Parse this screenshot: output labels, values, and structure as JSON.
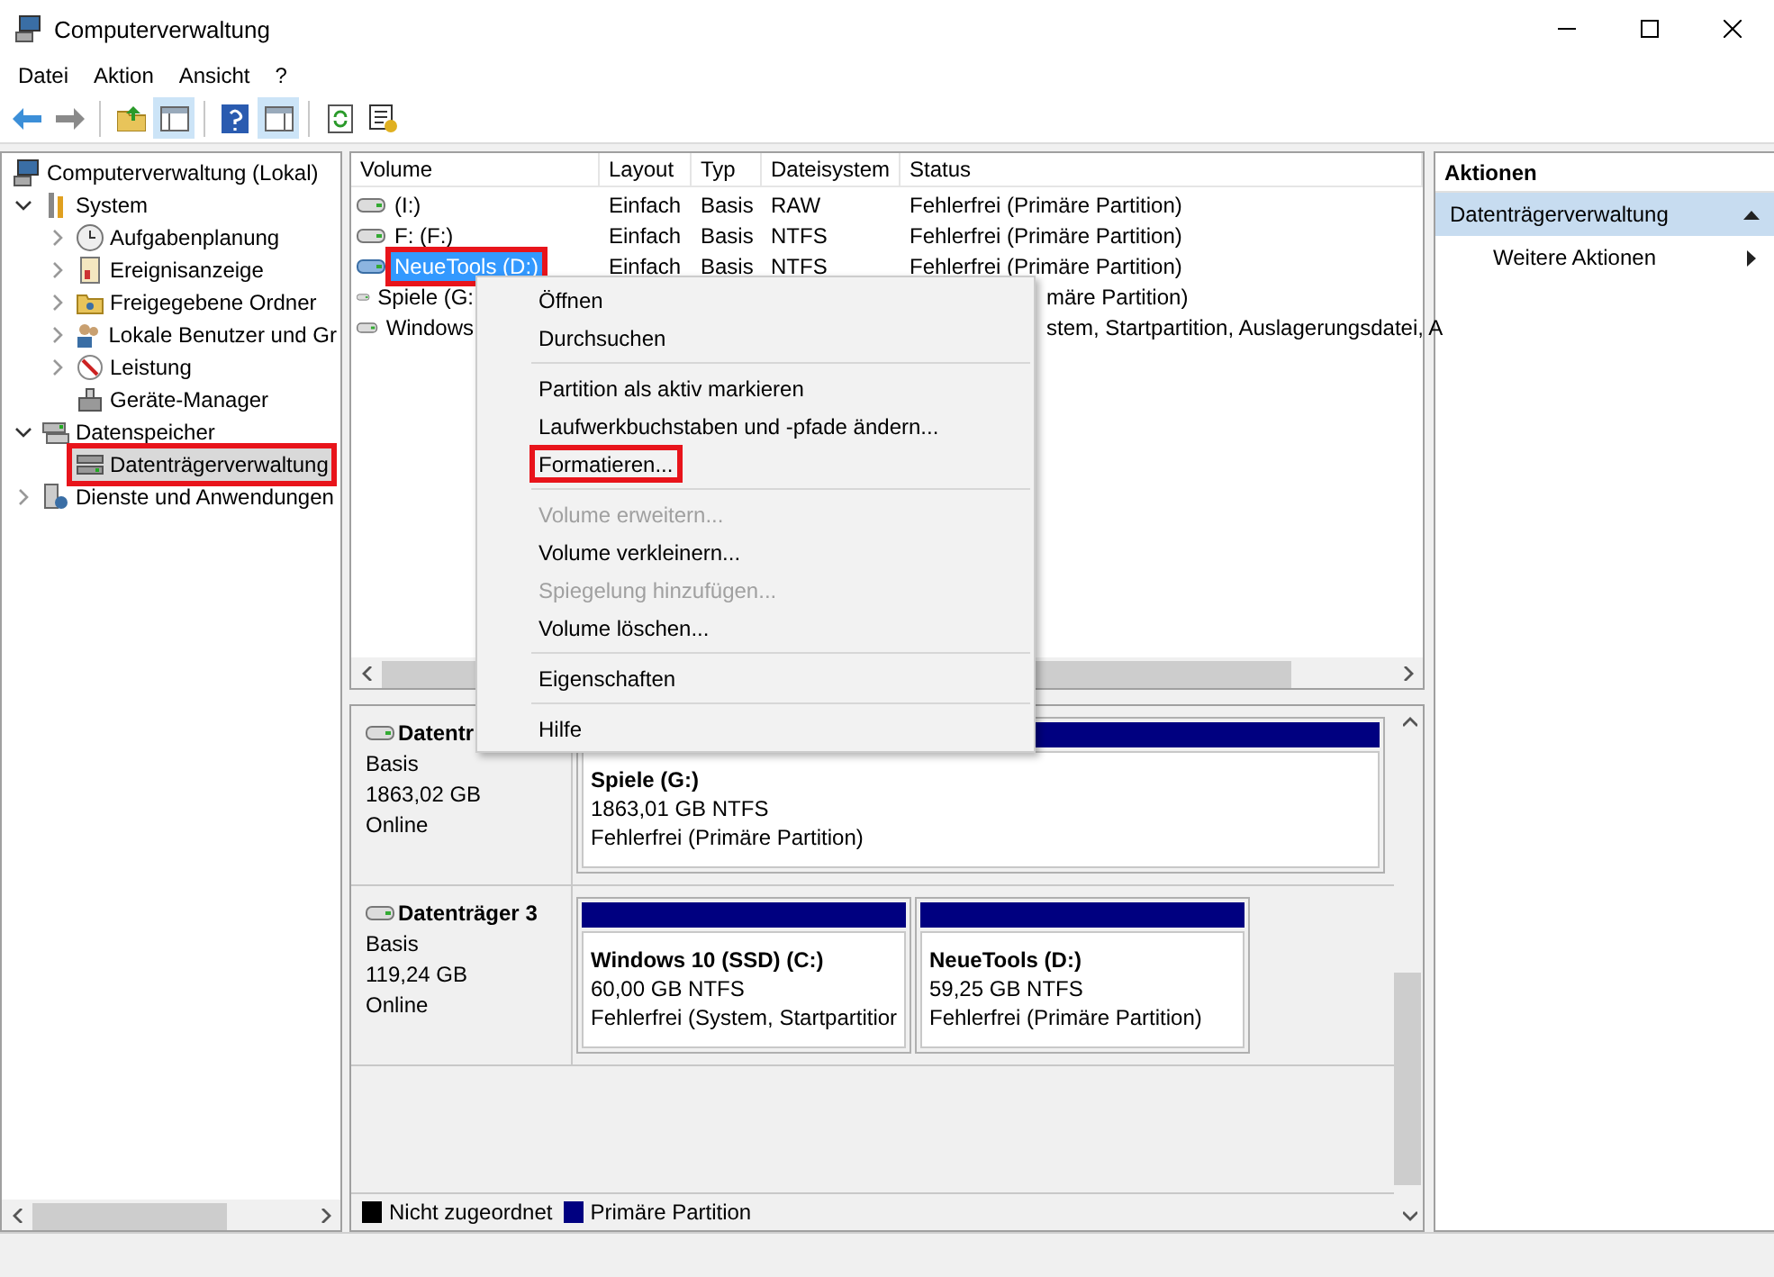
{
  "window": {
    "title": "Computerverwaltung"
  },
  "menu": [
    "Datei",
    "Aktion",
    "Ansicht",
    "?"
  ],
  "tree": [
    {
      "label": "Computerverwaltung (Lokal)",
      "selected": false,
      "highlighted": false,
      "children": [
        {
          "label": "System",
          "expanded": true,
          "selected": false,
          "highlighted": false,
          "children": [
            {
              "label": "Aufgabenplanung",
              "expanded": false,
              "selected": false,
              "highlighted": false
            },
            {
              "label": "Ereignisanzeige",
              "expanded": false,
              "selected": false,
              "highlighted": false
            },
            {
              "label": "Freigegebene Ordner",
              "expanded": false,
              "selected": false,
              "highlighted": false
            },
            {
              "label": "Lokale Benutzer und Gr",
              "expanded": false,
              "selected": false,
              "highlighted": false
            },
            {
              "label": "Leistung",
              "expanded": false,
              "selected": false,
              "highlighted": false
            },
            {
              "label": "Geräte-Manager",
              "selected": false,
              "highlighted": false
            }
          ]
        },
        {
          "label": "Datenspeicher",
          "expanded": true,
          "selected": false,
          "highlighted": false,
          "children": [
            {
              "label": "Datenträgerverwaltung",
              "selected": true,
              "highlighted": true
            }
          ]
        },
        {
          "label": "Dienste und Anwendungen",
          "expanded": false,
          "selected": false,
          "highlighted": false
        }
      ]
    }
  ],
  "volumes": {
    "columns": [
      "Volume",
      "Layout",
      "Typ",
      "Dateisystem",
      "Status"
    ],
    "rows": [
      {
        "covered": false,
        "selected": false,
        "highlighted": false,
        "cells": [
          "(I:)",
          "Einfach",
          "Basis",
          "RAW",
          "Fehlerfrei (Primäre Partition)"
        ]
      },
      {
        "covered": false,
        "selected": false,
        "highlighted": false,
        "cells": [
          "F: (F:)",
          "Einfach",
          "Basis",
          "NTFS",
          "Fehlerfrei (Primäre Partition)"
        ]
      },
      {
        "covered": false,
        "selected": true,
        "highlighted": true,
        "cells": [
          "NeueTools (D:)",
          "Einfach",
          "Basis",
          "NTFS",
          "Fehlerfrei (Primäre Partition)"
        ]
      },
      {
        "covered": true,
        "selected": false,
        "highlighted": false,
        "cells": [
          "Spiele (G:",
          "märe Partition)"
        ]
      },
      {
        "covered": true,
        "selected": false,
        "highlighted": false,
        "cells": [
          "Windows",
          "stem, Startpartition, Auslagerungsdatei, A"
        ]
      }
    ]
  },
  "context_menu": [
    {
      "kind": "item",
      "label": "Öffnen",
      "disabled": false,
      "highlighted": false
    },
    {
      "kind": "item",
      "label": "Durchsuchen",
      "disabled": false,
      "highlighted": false
    },
    {
      "kind": "separator"
    },
    {
      "kind": "item",
      "label": "Partition als aktiv markieren",
      "disabled": false,
      "highlighted": false
    },
    {
      "kind": "item",
      "label": "Laufwerkbuchstaben und -pfade ändern...",
      "disabled": false,
      "highlighted": false
    },
    {
      "kind": "item",
      "label": "Formatieren...",
      "disabled": false,
      "highlighted": true
    },
    {
      "kind": "separator"
    },
    {
      "kind": "item",
      "label": "Volume erweitern...",
      "disabled": true,
      "highlighted": false
    },
    {
      "kind": "item",
      "label": "Volume verkleinern...",
      "disabled": false,
      "highlighted": false
    },
    {
      "kind": "item",
      "label": "Spiegelung hinzufügen...",
      "disabled": true,
      "highlighted": false
    },
    {
      "kind": "item",
      "label": "Volume löschen...",
      "disabled": false,
      "highlighted": false
    },
    {
      "kind": "separator"
    },
    {
      "kind": "item",
      "label": "Eigenschaften",
      "disabled": false,
      "highlighted": false
    },
    {
      "kind": "separator"
    },
    {
      "kind": "item",
      "label": "Hilfe",
      "disabled": false,
      "highlighted": false
    }
  ],
  "disks": [
    {
      "name": "Datentr",
      "type": "Basis",
      "size": "1863,02 GB",
      "state": "Online",
      "partitions": [
        {
          "kind": "primary",
          "name": "Spiele (G:)",
          "size": "1863,01 GB NTFS",
          "status": "Fehlerfrei (Primäre Partition)"
        }
      ]
    },
    {
      "name": "Datenträger 3",
      "type": "Basis",
      "size": "119,24 GB",
      "state": "Online",
      "partitions": [
        {
          "kind": "primary",
          "name": "Windows 10 (SSD) (C:)",
          "size": "60,00 GB NTFS",
          "status": "Fehlerfrei (System, Startpartitior"
        },
        {
          "kind": "primary",
          "name": "NeueTools (D:)",
          "size": "59,25 GB NTFS",
          "status": "Fehlerfrei (Primäre Partition)"
        }
      ]
    }
  ],
  "legend": [
    {
      "label": "Nicht zugeordnet",
      "color": "#000000"
    },
    {
      "label": "Primäre Partition",
      "color": "#000080"
    }
  ],
  "actions": {
    "title": "Aktionen",
    "sections": [
      {
        "label": "Datenträgerverwaltung",
        "expanded": true,
        "items": [
          "Weitere Aktionen"
        ]
      }
    ]
  }
}
